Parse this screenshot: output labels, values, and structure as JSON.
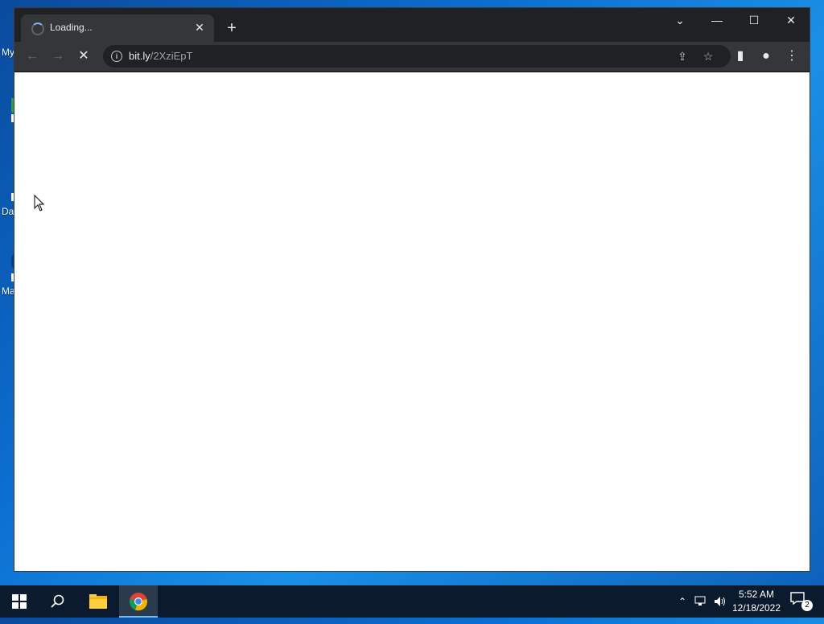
{
  "desktop": {
    "labels": [
      "My",
      "Da",
      "Ma"
    ]
  },
  "browser": {
    "tab": {
      "title": "Loading...",
      "close": "✕"
    },
    "new_tab": "+",
    "window_controls": {
      "dropdown": "⌄",
      "minimize": "—",
      "maximize": "☐",
      "close": "✕"
    },
    "toolbar": {
      "back": "←",
      "forward": "→",
      "stop": "✕",
      "url_host": "bit.ly",
      "url_path": "/2XziEpT"
    },
    "icons": {
      "info": "i",
      "share": "⇪",
      "bookmark": "☆",
      "side_panel": "▮",
      "profile": "●",
      "menu": "⋮"
    }
  },
  "taskbar": {
    "time": "5:52 AM",
    "date": "12/18/2022",
    "notifications_count": "2"
  }
}
